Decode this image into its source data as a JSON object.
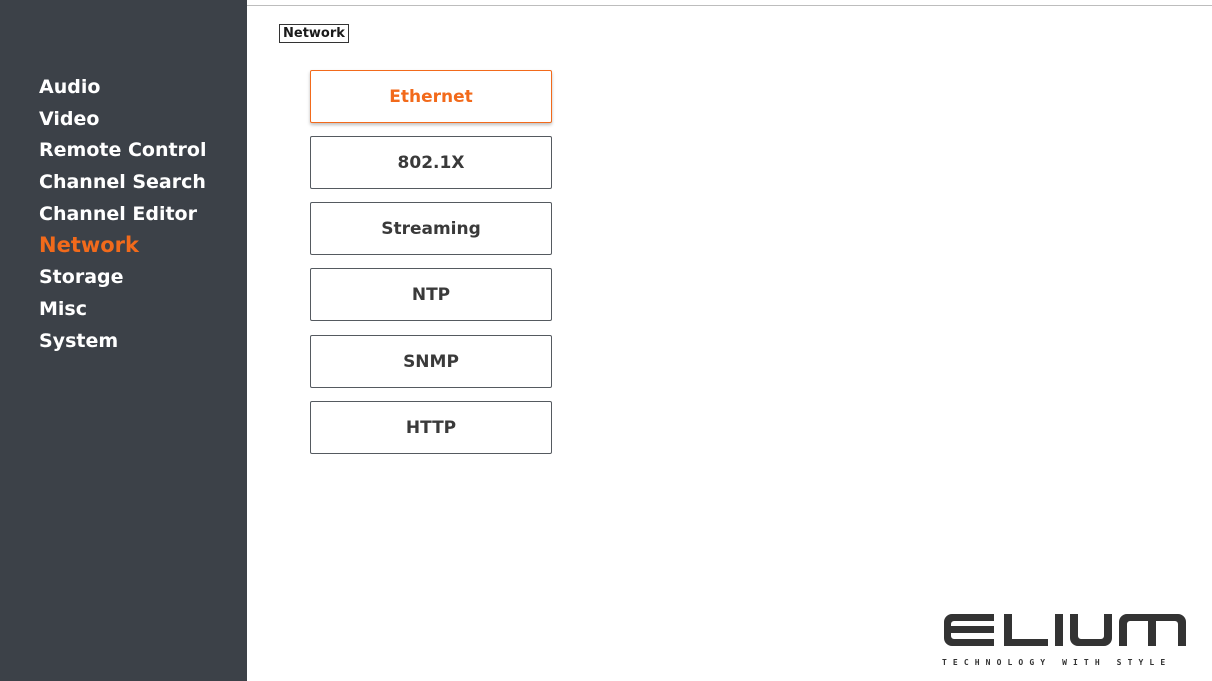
{
  "sidebar": {
    "items": [
      {
        "label": "Audio"
      },
      {
        "label": "Video"
      },
      {
        "label": "Remote Control"
      },
      {
        "label": "Channel Search"
      },
      {
        "label": "Channel Editor"
      },
      {
        "label": "Network",
        "active": true
      },
      {
        "label": "Storage"
      },
      {
        "label": "Misc"
      },
      {
        "label": "System"
      }
    ]
  },
  "breadcrumb": {
    "label": "Network"
  },
  "menu": {
    "buttons": [
      {
        "label": "Ethernet",
        "active": true
      },
      {
        "label": "802.1X"
      },
      {
        "label": "Streaming"
      },
      {
        "label": "NTP"
      },
      {
        "label": "SNMP"
      },
      {
        "label": "HTTP"
      }
    ]
  },
  "logo": {
    "brand": "ELIUM",
    "tagline": "TECHNOLOGY WITH STYLE"
  },
  "colors": {
    "accent": "#f26a1b",
    "sidebar_bg": "#3c4148",
    "text_light": "#ffffff"
  }
}
